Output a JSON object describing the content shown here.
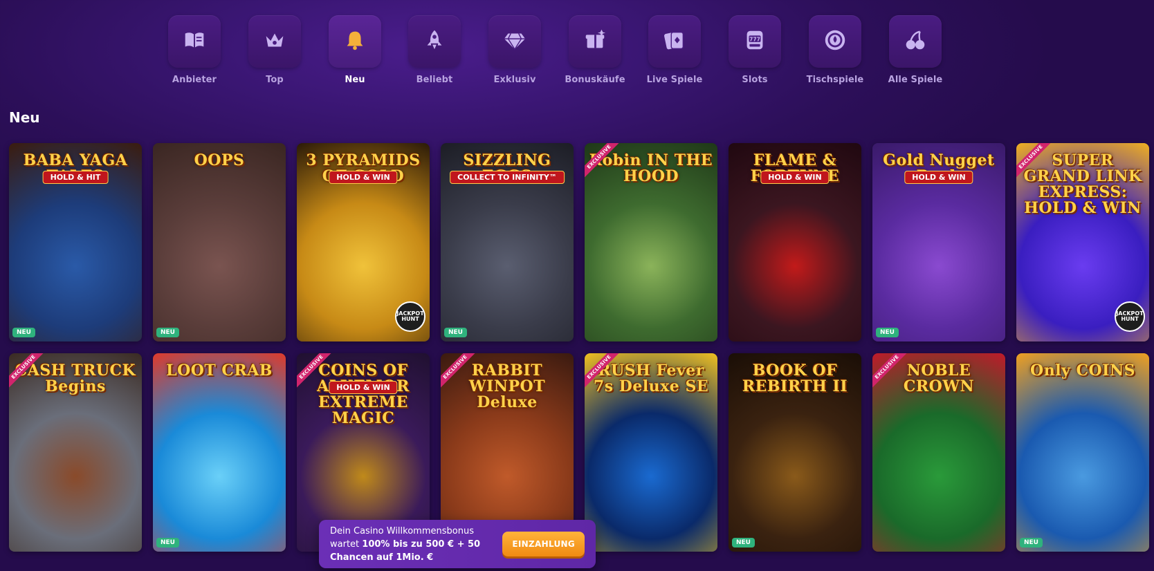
{
  "categories": [
    {
      "label": "Anbieter",
      "icon": "book-icon",
      "active": false
    },
    {
      "label": "Top",
      "icon": "crown-icon",
      "active": false
    },
    {
      "label": "Neu",
      "icon": "bell-icon",
      "active": true
    },
    {
      "label": "Beliebt",
      "icon": "rocket-icon",
      "active": false
    },
    {
      "label": "Exklusiv",
      "icon": "diamond-icon",
      "active": false
    },
    {
      "label": "Bonuskäufe",
      "icon": "gift-icon",
      "active": false
    },
    {
      "label": "Live Spiele",
      "icon": "cards-icon",
      "active": false
    },
    {
      "label": "Slots",
      "icon": "slot-machine-icon",
      "active": false
    },
    {
      "label": "Tischspiele",
      "icon": "chip-icon",
      "active": false
    },
    {
      "label": "Alle Spiele",
      "icon": "cherry-icon",
      "active": false
    }
  ],
  "section": {
    "title": "Neu"
  },
  "badges": {
    "new": "NEU",
    "exclusive": "EXCLUSIVE",
    "jackpot": "JACKPOT HUNT"
  },
  "games": [
    {
      "title": "BABA YAGA TALES",
      "sub": "HOLD & HIT",
      "new": true,
      "exclusive": false,
      "jackpot": false,
      "colors": [
        "#1d3c7a",
        "#2a5aa8",
        "#3b1c0e"
      ]
    },
    {
      "title": "OOPS",
      "sub": "",
      "new": true,
      "exclusive": false,
      "jackpot": false,
      "colors": [
        "#5a3d3a",
        "#7a5450",
        "#3a2622"
      ]
    },
    {
      "title": "3 PYRAMIDS OF GOLD",
      "sub": "HOLD & WIN",
      "new": false,
      "exclusive": false,
      "jackpot": true,
      "colors": [
        "#c78a16",
        "#f0c23a",
        "#2a1a08"
      ]
    },
    {
      "title": "SIZZLING EGGS",
      "sub": "COLLECT TO INFINITY™",
      "new": true,
      "exclusive": false,
      "jackpot": false,
      "colors": [
        "#3a3c4a",
        "#5a5e70",
        "#1c1d25"
      ]
    },
    {
      "title": "Robin IN THE HOOD",
      "sub": "",
      "new": false,
      "exclusive": true,
      "jackpot": false,
      "colors": [
        "#3e6b2f",
        "#8bb35a",
        "#1f3818"
      ]
    },
    {
      "title": "FLAME & FORTUNE",
      "sub": "HOLD & WIN",
      "new": false,
      "exclusive": false,
      "jackpot": false,
      "colors": [
        "#3b1620",
        "#c21a1a",
        "#200810"
      ]
    },
    {
      "title": "Gold Nugget Rush",
      "sub": "HOLD & WIN",
      "new": true,
      "exclusive": false,
      "jackpot": false,
      "colors": [
        "#5a2ba0",
        "#8a4ad0",
        "#3a1a6a"
      ]
    },
    {
      "title": "SUPER GRAND LINK EXPRESS: HOLD & WIN",
      "sub": "",
      "new": false,
      "exclusive": true,
      "jackpot": true,
      "colors": [
        "#3a1ec0",
        "#6a3cf0",
        "#f0b020"
      ]
    },
    {
      "title": "CASH TRUCK Begins",
      "sub": "",
      "new": false,
      "exclusive": true,
      "jackpot": false,
      "colors": [
        "#6a6e7a",
        "#8a4a2a",
        "#3a2a22"
      ]
    },
    {
      "title": "LOOT CRAB",
      "sub": "",
      "new": true,
      "exclusive": false,
      "jackpot": false,
      "colors": [
        "#1a8ad8",
        "#6ad0f8",
        "#e03a2a"
      ]
    },
    {
      "title": "COINS OF ALKEMOR EXTREME MAGIC",
      "sub": "HOLD & WIN",
      "new": false,
      "exclusive": true,
      "jackpot": false,
      "colors": [
        "#3a1a5a",
        "#c08a1a",
        "#201030"
      ]
    },
    {
      "title": "RABBIT WINPOT Deluxe",
      "sub": "",
      "new": false,
      "exclusive": true,
      "jackpot": false,
      "colors": [
        "#8a3a1a",
        "#c05a2a",
        "#3a1a10"
      ]
    },
    {
      "title": "RUSH Fever 7s Deluxe SE",
      "sub": "",
      "new": false,
      "exclusive": true,
      "jackpot": false,
      "colors": [
        "#0a2a6a",
        "#1a6ad0",
        "#f0c020"
      ]
    },
    {
      "title": "BOOK OF REBIRTH II",
      "sub": "",
      "new": true,
      "exclusive": false,
      "jackpot": false,
      "colors": [
        "#3a2210",
        "#8a5a1a",
        "#1a0e06"
      ]
    },
    {
      "title": "NOBLE CROWN",
      "sub": "",
      "new": false,
      "exclusive": true,
      "jackpot": false,
      "colors": [
        "#1a6a2a",
        "#2a9a3a",
        "#c01a2a"
      ]
    },
    {
      "title": "Only COINS",
      "sub": "",
      "new": true,
      "exclusive": false,
      "jackpot": false,
      "colors": [
        "#1a5ab0",
        "#4a9ae0",
        "#f0a020"
      ]
    }
  ],
  "promo": {
    "text_pre": "Dein Casino Willkommensbonus wartet ",
    "text_bold1": "100% bis zu 500 € + 50 Chancen auf 1Mio. €",
    "button": "EINZAHLUNG"
  }
}
